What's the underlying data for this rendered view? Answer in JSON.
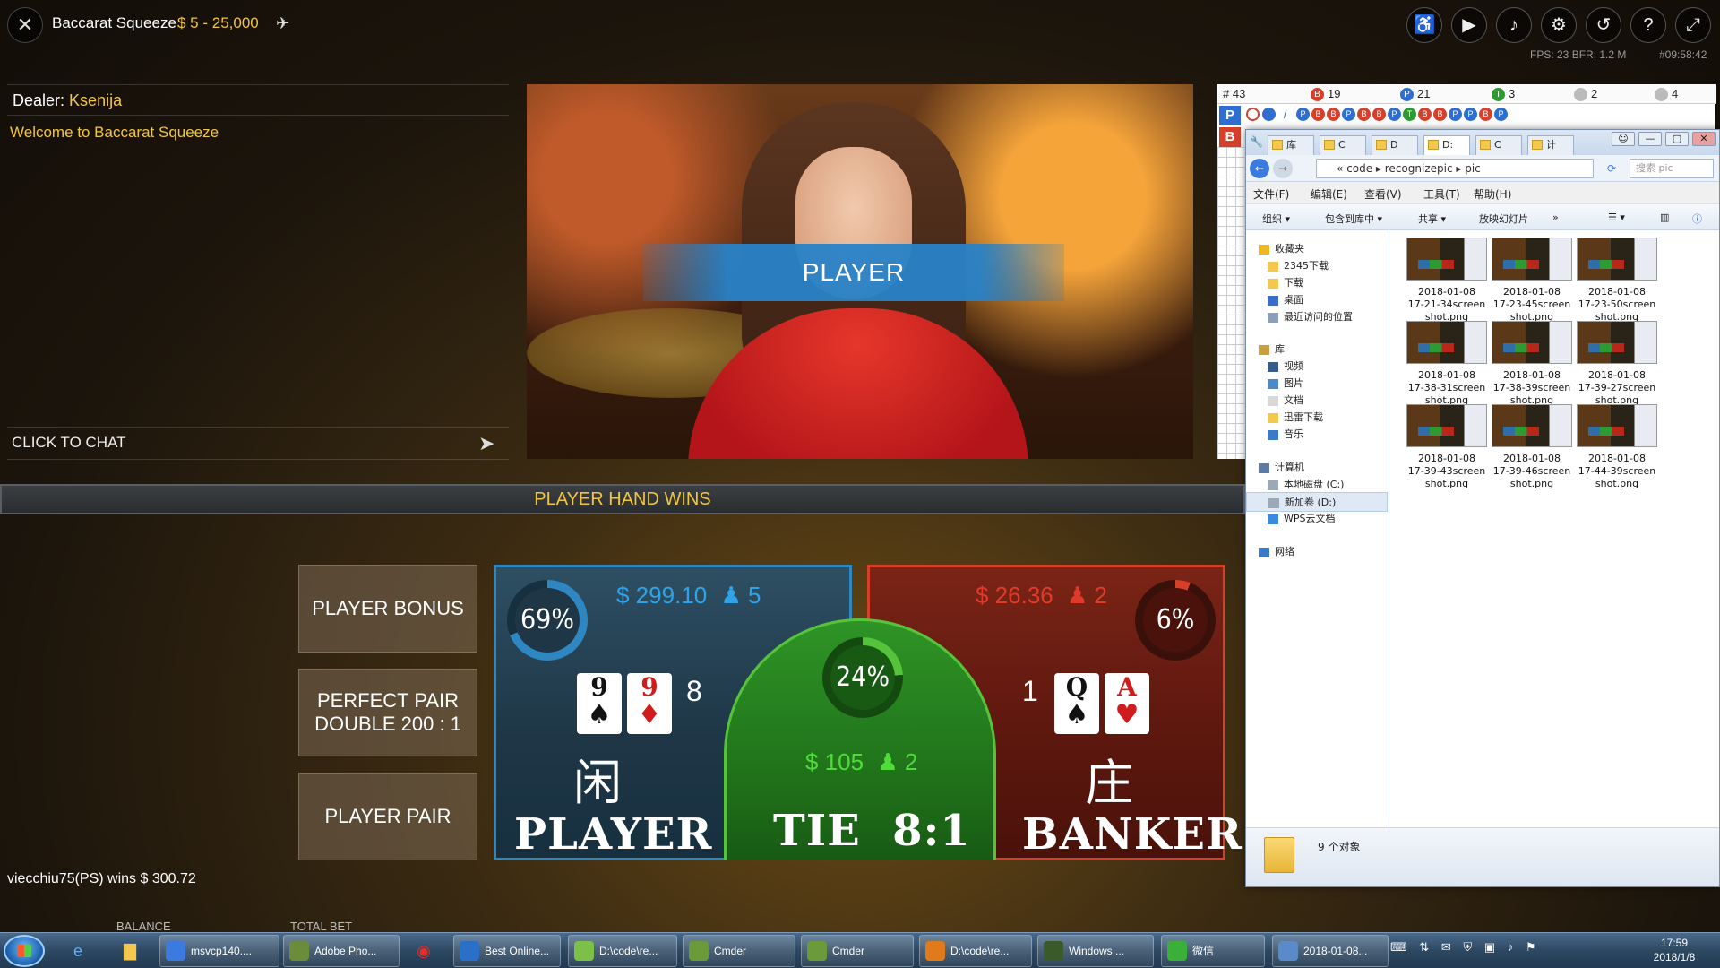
{
  "header": {
    "title": "Baccarat Squeeze",
    "limits": "$ 5 - 25,000",
    "fps_info": "FPS: 23 BFR: 1.2   M",
    "round_id": "#09:58:42"
  },
  "chat": {
    "dealer_label": "Dealer:",
    "dealer_name": "Ksenija",
    "welcome": "Welcome to Baccarat Squeeze",
    "click_to_chat": "CLICK TO CHAT"
  },
  "video": {
    "banner": "PLAYER"
  },
  "roadmap": {
    "total": "# 43",
    "banker_count": "19",
    "player_count": "21",
    "tie_count": "3",
    "banker_pair": "2",
    "player_pair": "4",
    "p_btn": "P",
    "b_btn": "B",
    "bead_letters": [
      "P",
      "B",
      "B",
      "P",
      "B",
      "B",
      "P",
      "T",
      "B",
      "B",
      "P",
      "P",
      "B",
      "P"
    ]
  },
  "result": {
    "text": "PLAYER HAND WINS"
  },
  "side_bets": {
    "player_bonus": "PLAYER BONUS",
    "perfect_pair_1": "PERFECT PAIR",
    "perfect_pair_2": "DOUBLE 200 : 1",
    "player_pair": "PLAYER PAIR"
  },
  "player": {
    "stake": "$ 299.10",
    "players": "5",
    "percent": "69%",
    "percent_value": 0.69,
    "cards": [
      {
        "rank": "9",
        "suit": "♠",
        "color": "black"
      },
      {
        "rank": "9",
        "suit": "♦",
        "color": "red"
      }
    ],
    "score": "8",
    "cn": "闲",
    "label": "PLAYER"
  },
  "tie": {
    "stake": "$ 105",
    "players": "2",
    "percent": "24%",
    "percent_value": 0.24,
    "label": "TIE  8:1"
  },
  "banker": {
    "stake": "$ 26.36",
    "players": "2",
    "percent": "6%",
    "percent_value": 0.06,
    "cards": [
      {
        "rank": "Q",
        "suit": "♠",
        "color": "black"
      },
      {
        "rank": "A",
        "suit": "♥",
        "color": "red"
      }
    ],
    "score": "1",
    "cn": "庄",
    "label": "BANKER"
  },
  "bottom": {
    "win_msg": "viecchiu75(PS) wins $ 300.72",
    "balance_label": "BALANCE",
    "total_bet_label": "TOTAL BET"
  },
  "explorer": {
    "tabs": [
      "库",
      "C",
      "D",
      "D:",
      "C",
      "计"
    ],
    "path": [
      "code",
      "recognizepic",
      "pic"
    ],
    "search_placeholder": "搜索 pic",
    "menu": [
      "文件(F)",
      "编辑(E)",
      "查看(V)",
      "工具(T)",
      "帮助(H)"
    ],
    "commands": [
      "组织 ▾",
      "包含到库中 ▾",
      "共享 ▾",
      "放映幻灯片",
      "»"
    ],
    "nav": [
      {
        "label": "收藏夹",
        "icon": "star-icon"
      },
      {
        "label": "2345下载",
        "icon": "folder-icon"
      },
      {
        "label": "下载",
        "icon": "folder-icon"
      },
      {
        "label": "桌面",
        "icon": "desktop-icon"
      },
      {
        "label": "最近访问的位置",
        "icon": "recent-icon"
      },
      {
        "label": "库",
        "icon": "library-icon"
      },
      {
        "label": "视频",
        "icon": "video-icon"
      },
      {
        "label": "图片",
        "icon": "picture-icon"
      },
      {
        "label": "文档",
        "icon": "document-icon"
      },
      {
        "label": "迅雷下载",
        "icon": "folder-icon"
      },
      {
        "label": "音乐",
        "icon": "music-icon"
      },
      {
        "label": "计算机",
        "icon": "computer-icon"
      },
      {
        "label": "本地磁盘 (C:)",
        "icon": "drive-icon"
      },
      {
        "label": "新加卷 (D:)",
        "icon": "drive-icon"
      },
      {
        "label": "WPS云文档",
        "icon": "cloud-icon"
      },
      {
        "label": "网络",
        "icon": "network-icon"
      }
    ],
    "files": [
      {
        "line1": "2018-01-08",
        "line2": "17-21-34screen",
        "line3": "shot.png"
      },
      {
        "line1": "2018-01-08",
        "line2": "17-23-45screen",
        "line3": "shot.png"
      },
      {
        "line1": "2018-01-08",
        "line2": "17-23-50screen",
        "line3": "shot.png"
      },
      {
        "line1": "2018-01-08",
        "line2": "17-38-31screen",
        "line3": "shot.png"
      },
      {
        "line1": "2018-01-08",
        "line2": "17-38-39screen",
        "line3": "shot.png"
      },
      {
        "line1": "2018-01-08",
        "line2": "17-39-27screen",
        "line3": "shot.png"
      },
      {
        "line1": "2018-01-08",
        "line2": "17-39-43screen",
        "line3": "shot.png"
      },
      {
        "line1": "2018-01-08",
        "line2": "17-39-46screen",
        "line3": "shot.png"
      },
      {
        "line1": "2018-01-08",
        "line2": "17-44-39screen",
        "line3": "shot.png"
      }
    ],
    "status": "9 个对象"
  },
  "taskbar": {
    "tasks": [
      {
        "label": "msvcp140....",
        "color": "#3b7be0"
      },
      {
        "label": "Adobe Pho...",
        "color": "#6b8c3a"
      },
      {
        "label": "Best Online...",
        "color": "#2a6fc8"
      },
      {
        "label": "D:\\code\\re...",
        "color": "#7cc04a"
      },
      {
        "label": "Cmder",
        "color": "#6a9a3a"
      },
      {
        "label": "Cmder",
        "color": "#6a9a3a"
      },
      {
        "label": "D:\\code\\re...",
        "color": "#e07a1a"
      },
      {
        "label": "Windows ...",
        "color": "#3a5a2a"
      },
      {
        "label": "微信",
        "color": "#3ab03a"
      },
      {
        "label": "2018-01-08...",
        "color": "#5a8ac8"
      }
    ],
    "time": "17:59",
    "date": "2018/1/8"
  },
  "colors": {
    "gold": "#f2c63a",
    "player_blue": "#2f87c2",
    "banker_red": "#d6402b",
    "tie_green": "#55c43a"
  }
}
